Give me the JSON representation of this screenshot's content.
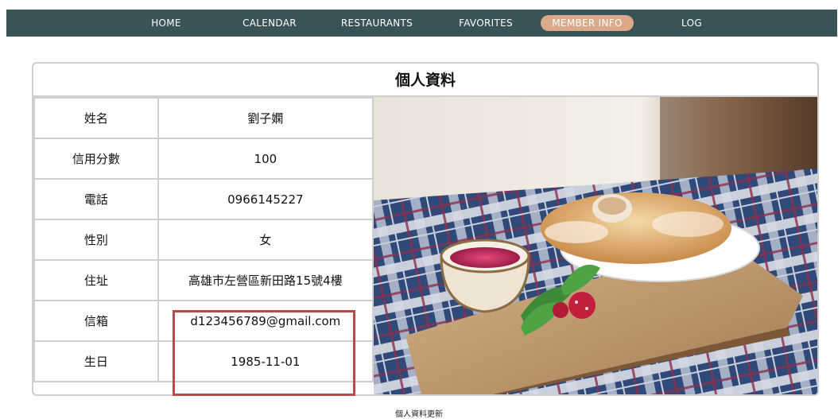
{
  "nav": {
    "items": [
      {
        "label": "HOME"
      },
      {
        "label": "CALENDAR"
      },
      {
        "label": "RESTAURANTS"
      },
      {
        "label": "FAVORITES"
      },
      {
        "label": "MEMBER INFO",
        "active": true
      },
      {
        "label": "LOG OUT"
      }
    ],
    "bar_color": "#3a5357",
    "active_color": "#d9a989"
  },
  "profile": {
    "title": "個人資料",
    "rows": [
      {
        "label": "姓名",
        "value": "劉子嫻"
      },
      {
        "label": "信用分數",
        "value": "100"
      },
      {
        "label": "電話",
        "value": "0966145227"
      },
      {
        "label": "性別",
        "value": "女"
      },
      {
        "label": "住址",
        "value": "高雄市左營區新田路15號4樓"
      },
      {
        "label": "信箱",
        "value": "d123456789@gmail.com"
      },
      {
        "label": "生日",
        "value": "1985-11-01"
      }
    ]
  },
  "photo": {
    "icon": "food-photo-image"
  },
  "footer": {
    "update_label": "個人資料更新"
  },
  "highlight_color": "#b94a4a"
}
